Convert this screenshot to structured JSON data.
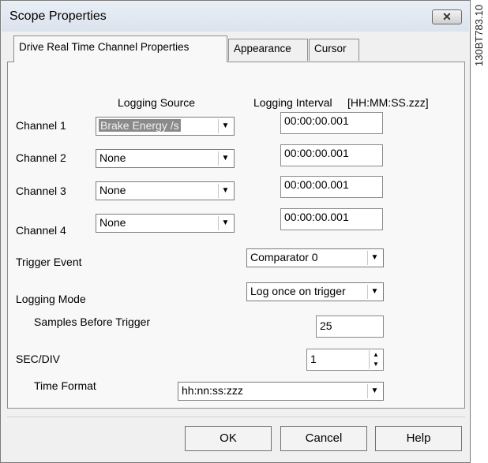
{
  "window": {
    "title": "Scope Properties",
    "close_glyph": "✕",
    "side_code": "130BT783.10"
  },
  "tabs": [
    {
      "label": "Drive Real Time Channel Properties",
      "active": true
    },
    {
      "label": "Appearance",
      "active": false
    },
    {
      "label": "Cursor",
      "active": false
    }
  ],
  "headers": {
    "logging_source": "Logging Source",
    "logging_interval": "Logging Interval",
    "interval_format": "[HH:MM:SS.zzz]"
  },
  "channels": [
    {
      "label": "Channel 1",
      "source": "Brake Energy /s",
      "interval": "00:00:00.001",
      "selected": true
    },
    {
      "label": "Channel 2",
      "source": "None",
      "interval": "00:00:00.001"
    },
    {
      "label": "Channel 3",
      "source": "None",
      "interval": "00:00:00.001"
    },
    {
      "label": "Channel 4",
      "source": "None",
      "interval": "00:00:00.001"
    }
  ],
  "trigger_event": {
    "label": "Trigger Event",
    "value": "Comparator 0"
  },
  "logging_mode": {
    "label": "Logging Mode",
    "value": "Log once on trigger"
  },
  "samples_before_trigger": {
    "label": "Samples Before Trigger",
    "value": "25"
  },
  "sec_div": {
    "label": "SEC/DIV",
    "value": "1"
  },
  "time_format": {
    "label": "Time Format",
    "value": "hh:nn:ss:zzz"
  },
  "buttons": {
    "ok": "OK",
    "cancel": "Cancel",
    "help": "Help"
  },
  "icons": {
    "dropdown": "chevron-down-icon",
    "spin_up": "spin-up-icon",
    "spin_down": "spin-down-icon"
  }
}
